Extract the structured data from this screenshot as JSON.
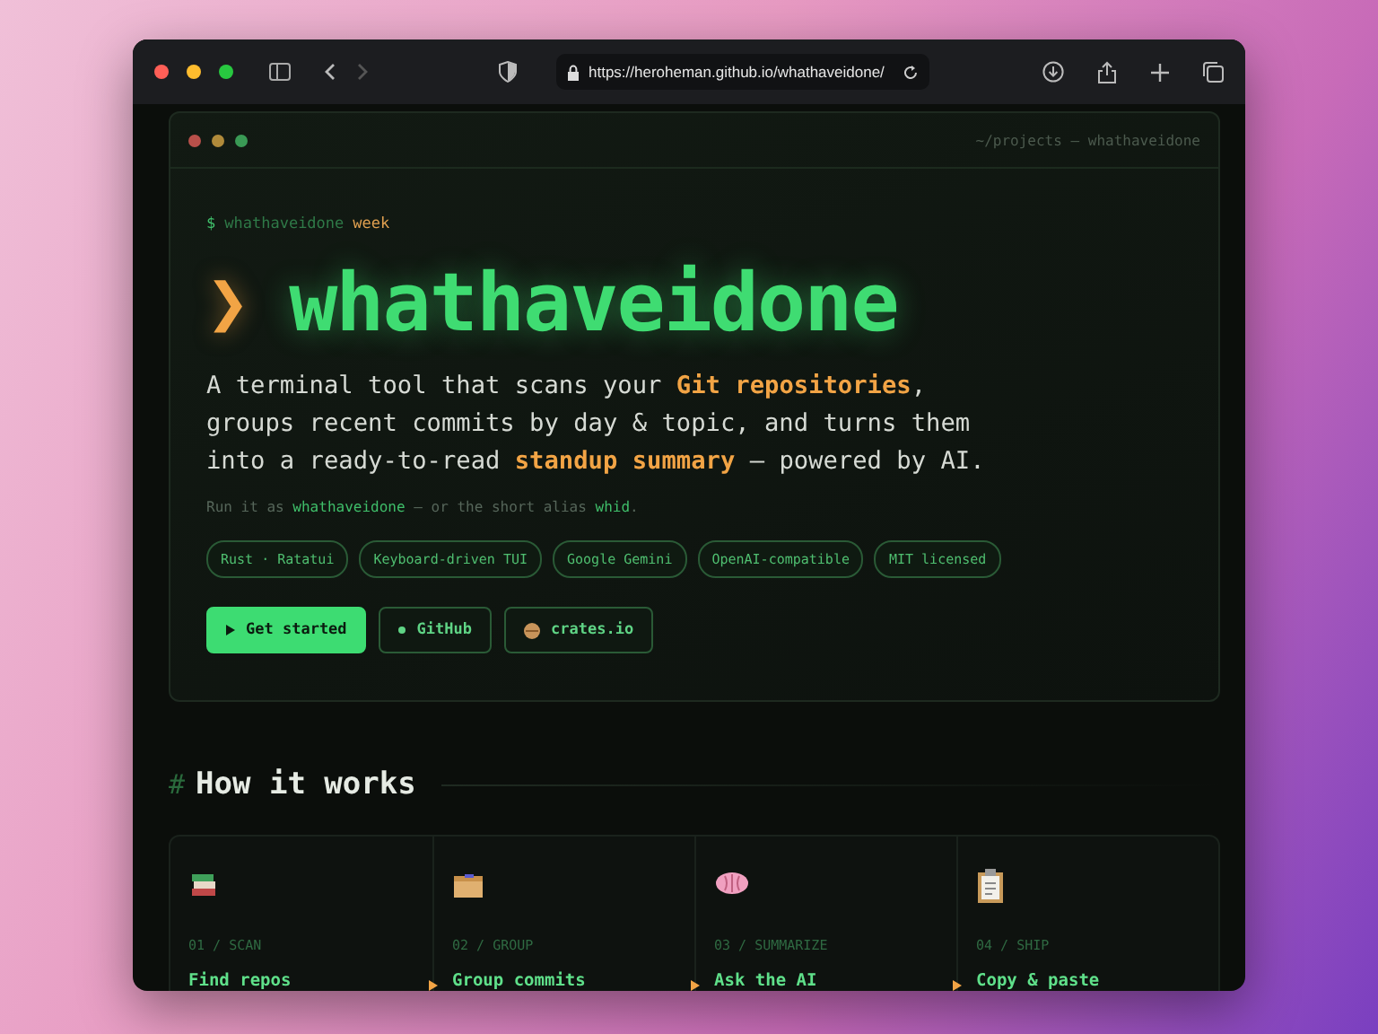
{
  "browser": {
    "url": "https://heroheman.github.io/whathaveidone/"
  },
  "terminal": {
    "path": "~/projects — whathaveidone",
    "prompt": {
      "symbol": "$",
      "command": "whathaveidone",
      "argument": "week"
    },
    "title_glyph": "❯",
    "title": "whathaveidone",
    "tagline": "A terminal tool that scans your **Git repositories**, groups recent commits by day & topic, and turns them into a ready-to-read **standup summary** — powered by AI.",
    "note": "Run it as **whathaveidone** — or the short alias **whid**.",
    "tags": [
      "Rust · Ratatui",
      "Keyboard-driven TUI",
      "Google Gemini",
      "OpenAI-compatible",
      "MIT licensed"
    ],
    "buttons": [
      {
        "kind": "primary",
        "label": "Get started"
      },
      {
        "kind": "github",
        "label": "GitHub"
      },
      {
        "kind": "crate",
        "label": "crates.io"
      }
    ]
  },
  "section": {
    "hash": "#",
    "title": "How it works"
  },
  "steps": [
    {
      "kind": "books",
      "label": "01 / SCAN",
      "title": "Find repos"
    },
    {
      "kind": "box",
      "label": "02 / GROUP",
      "title": "Group commits"
    },
    {
      "kind": "brain",
      "label": "03 / SUMMARIZE",
      "title": "Ask the AI"
    },
    {
      "kind": "clipboard",
      "label": "04 / SHIP",
      "title": "Copy & paste"
    }
  ]
}
